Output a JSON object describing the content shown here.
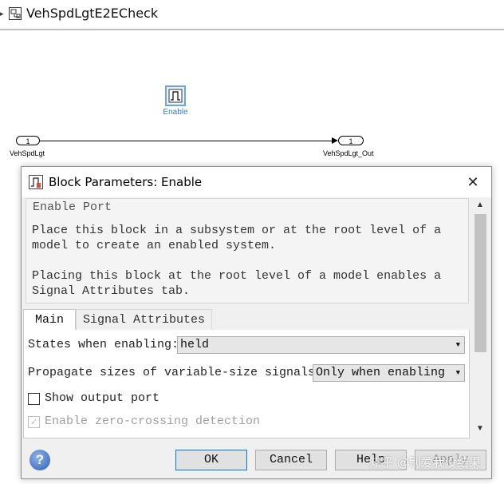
{
  "editor": {
    "model_title": "VehSpdLgtE2ECheck",
    "enable_block_label": "Enable",
    "inport_number": "1",
    "inport_name": "VehSpdLgt",
    "outport_number": "1",
    "outport_name": "VehSpdLgt_Out"
  },
  "dialog": {
    "title": "Block Parameters: Enable",
    "close_glyph": "✕",
    "group_title": "Enable Port",
    "description_1": "Place this block in a subsystem or at the root level of a model to create an enabled system.",
    "description_2": "Placing this block at the root level of a model enables a Signal Attributes tab.",
    "tabs": [
      {
        "label": "Main",
        "active": true
      },
      {
        "label": "Signal Attributes",
        "active": false
      }
    ],
    "params": {
      "states_label": "States when enabling:",
      "states_value": "held",
      "propagate_label": "Propagate sizes of variable-size signals:",
      "propagate_value": "Only when enabling",
      "show_output_label": "Show output port",
      "show_output_checked": false,
      "zero_crossing_label": "Enable zero-crossing detection",
      "zero_crossing_checked": true,
      "zero_crossing_enabled": false
    },
    "buttons": {
      "ok": "OK",
      "cancel": "Cancel",
      "help": "Help",
      "apply": "Apply"
    },
    "help_icon_glyph": "?",
    "watermark": "知乎 @别爱我没结果"
  },
  "icons": {
    "model_icon": "subsystem-icon",
    "dialog_icon": "block-parameters-icon",
    "enable_block_icon": "pulse-icon"
  },
  "colors": {
    "enable_block_border": "#6aa7d8",
    "enable_label": "#2c7fc7",
    "ok_border": "#0078d7"
  }
}
